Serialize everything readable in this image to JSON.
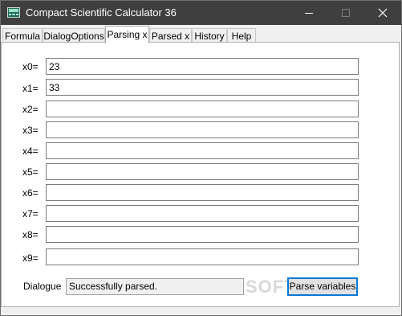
{
  "window": {
    "title": "Compact Scientific Calculator 36"
  },
  "tabs": [
    {
      "label": "Formula"
    },
    {
      "label": "DialogOptions"
    },
    {
      "label": "Parsing x",
      "active": true
    },
    {
      "label": "Parsed x"
    },
    {
      "label": "History"
    },
    {
      "label": "Help"
    }
  ],
  "variables": [
    {
      "label": "x0=",
      "value": "23"
    },
    {
      "label": "x1=",
      "value": "33"
    },
    {
      "label": "x2=",
      "value": ""
    },
    {
      "label": "x3=",
      "value": ""
    },
    {
      "label": "x4=",
      "value": ""
    },
    {
      "label": "x5=",
      "value": ""
    },
    {
      "label": "x6=",
      "value": ""
    },
    {
      "label": "x7=",
      "value": ""
    },
    {
      "label": "x8=",
      "value": ""
    },
    {
      "label": "x9=",
      "value": ""
    }
  ],
  "dialogue": {
    "label": "Dialogue",
    "value": "Successfully parsed."
  },
  "parse_button": {
    "label": "Parse variables"
  },
  "watermark": "SOFTPEDIA",
  "colors": {
    "titlebar": "#3f3f3f",
    "focus_border": "#0078d7"
  }
}
